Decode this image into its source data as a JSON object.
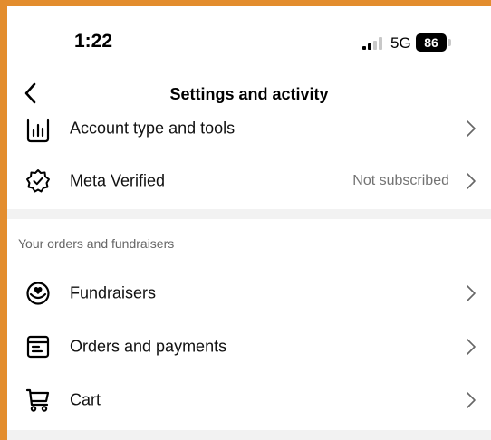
{
  "status_bar": {
    "time": "1:22",
    "network": "5G",
    "battery": "86"
  },
  "nav": {
    "title": "Settings and activity",
    "back_icon": "chevron-left-icon"
  },
  "section1": {
    "rows": [
      {
        "label": "Account type and tools",
        "value": "",
        "icon": "bar-chart-icon"
      },
      {
        "label": "Meta Verified",
        "value": "Not subscribed",
        "icon": "verified-badge-icon"
      }
    ]
  },
  "section2": {
    "header": "Your orders and fundraisers",
    "rows": [
      {
        "label": "Fundraisers",
        "value": "",
        "icon": "heart-coin-icon"
      },
      {
        "label": "Orders and payments",
        "value": "",
        "icon": "receipt-icon"
      },
      {
        "label": "Cart",
        "value": "",
        "icon": "cart-icon"
      }
    ]
  },
  "colors": {
    "frame_border": "#e38d2e",
    "divider": "#f2f2f2",
    "secondary_text": "#737373"
  }
}
